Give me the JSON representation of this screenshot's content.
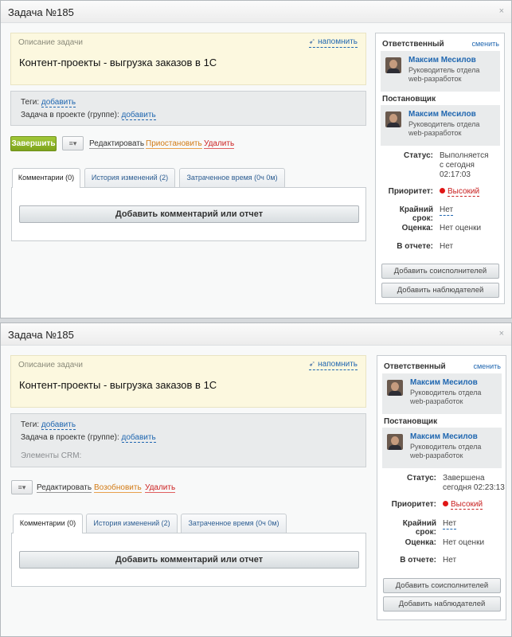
{
  "w1": {
    "title": "Задача №185",
    "close": "×",
    "desc_label": "Описание задачи",
    "remind": "напомнить",
    "task_title": "Контент-проекты - выгрузка заказов в 1С",
    "tags_label": "Теги:",
    "tags_add": "добавить",
    "project_label": "Задача в проекте (группе):",
    "project_add": "добавить",
    "finish": "Завершить",
    "menu": "▾",
    "edit": "Редактировать",
    "pause": "Приостановить",
    "delete": "Удалить",
    "tabs": [
      "Комментарии (0)",
      "История изменений (2)",
      "Затраченное время (0ч 0м)"
    ],
    "add_comment": "Добавить комментарий или отчет",
    "resp_head": "Ответственный",
    "resp_change": "сменить",
    "resp_name": "Максим Месилов",
    "resp_role1": "Руководитель отдела",
    "resp_role2": "web-разработок",
    "creator_head": "Постановщик",
    "creator_name": "Максим Месилов",
    "creator_role1": "Руководитель отдела",
    "creator_role2": "web-разработок",
    "status_label": "Статус:",
    "status1": "Выполняется",
    "status2": "с сегодня",
    "status3": "02:17:03",
    "prio_label": "Приоритет:",
    "prio": "Высокий",
    "deadline_label": "Крайний срок:",
    "deadline": "Нет",
    "mark_label": "Оценка:",
    "mark": "Нет оценки",
    "report_label": "В отчете:",
    "report": "Нет",
    "add_acc": "Добавить соисполнителей",
    "add_obs": "Добавить наблюдателей"
  },
  "w2": {
    "title": "Задача №185",
    "close": "×",
    "desc_label": "Описание задачи",
    "remind": "напомнить",
    "task_title": "Контент-проекты - выгрузка заказов в 1С",
    "tags_label": "Теги:",
    "tags_add": "добавить",
    "project_label": "Задача в проекте (группе):",
    "project_add": "добавить",
    "crm_label": "Элементы CRM:",
    "menu": "▾",
    "edit": "Редактировать",
    "resume": "Возобновить",
    "delete": "Удалить",
    "tabs": [
      "Комментарии (0)",
      "История изменений (2)",
      "Затраченное время (0ч 0м)"
    ],
    "add_comment": "Добавить комментарий или отчет",
    "resp_head": "Ответственный",
    "resp_change": "сменить",
    "resp_name": "Максим Месилов",
    "resp_role1": "Руководитель отдела",
    "resp_role2": "web-разработок",
    "creator_head": "Постановщик",
    "creator_name": "Максим Месилов",
    "creator_role1": "Руководитель отдела",
    "creator_role2": "web-разработок",
    "status_label": "Статус:",
    "status1": "Завершена",
    "status2": "сегодня 02:23:13",
    "prio_label": "Приоритет:",
    "prio": "Высокий",
    "deadline_label": "Крайний срок:",
    "deadline": "Нет",
    "mark_label": "Оценка:",
    "mark": "Нет оценки",
    "report_label": "В отчете:",
    "report": "Нет",
    "add_acc": "Добавить соисполнителей",
    "add_obs": "Добавить наблюдателей"
  }
}
